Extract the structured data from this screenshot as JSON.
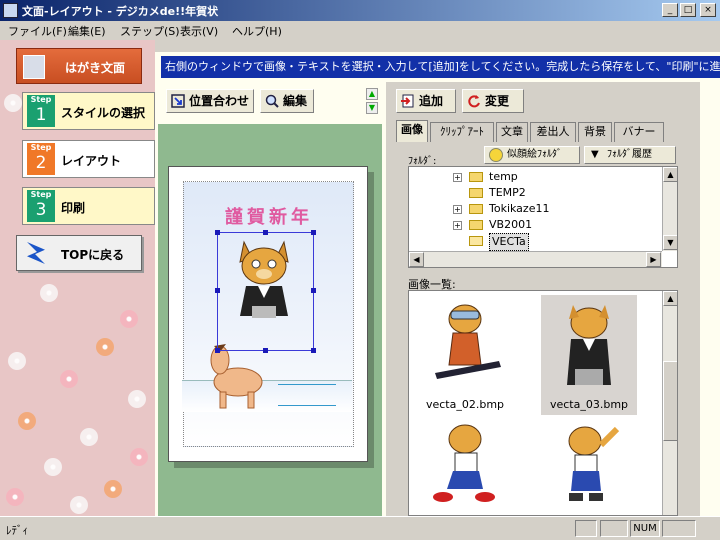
{
  "window": {
    "title": "文面-レイアウト - デジカメde!!年賀状",
    "minimize": "_",
    "maximize": "□",
    "close": "×"
  },
  "menu": [
    "ファイル(F)",
    "編集(E)",
    "ステップ(S)",
    "表示(V)",
    "ヘルプ(H)"
  ],
  "left": {
    "hagaki_label": "はがき文面",
    "steps": [
      {
        "badge_word": "Step",
        "num": "1",
        "label": "スタイルの選択",
        "color": "#1aa070"
      },
      {
        "badge_word": "Step",
        "num": "2",
        "label": "レイアウト",
        "color": "#f07828"
      },
      {
        "badge_word": "Step",
        "num": "3",
        "label": "印刷",
        "color": "#1aa070"
      }
    ],
    "top_label": "TOPに戻る"
  },
  "instruction": "右側のウィンドウで画像・テキストを選択・入力して[追加]をしてください。完成したら保存をして、\"印刷\"に進",
  "toolbar": {
    "align_label": "位置合わせ",
    "edit_label": "編集",
    "add_label": "追加",
    "change_label": "変更"
  },
  "card": {
    "title": "謹賀新年"
  },
  "tabs": [
    "画像",
    "ｸﾘｯﾌﾟｱｰﾄ",
    "文章",
    "差出人",
    "背景",
    "バナー"
  ],
  "folder": {
    "label": "ﾌｫﾙﾀﾞ:",
    "face_btn": "似顔絵ﾌｫﾙﾀﾞ",
    "history_btn": "ﾌｫﾙﾀﾞ履歴",
    "tree": [
      {
        "name": "temp",
        "expand": "+"
      },
      {
        "name": "TEMP2",
        "expand": ""
      },
      {
        "name": "Tokikaze11",
        "expand": "+"
      },
      {
        "name": "VB2001",
        "expand": "+"
      },
      {
        "name": "VECTa",
        "expand": "",
        "selected": true
      }
    ]
  },
  "images": {
    "label": "画像一覧:",
    "items": [
      {
        "name": "vecta_02.bmp"
      },
      {
        "name": "vecta_03.bmp"
      },
      {
        "name": ""
      },
      {
        "name": ""
      }
    ]
  },
  "status": {
    "text": "ﾚﾃﾞｨ",
    "num": "NUM"
  }
}
